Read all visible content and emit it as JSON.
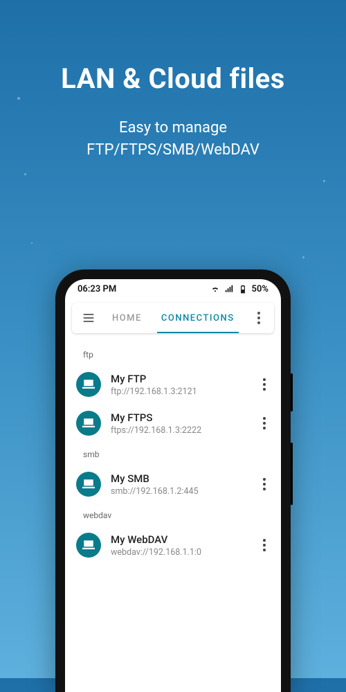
{
  "promo": {
    "title": "LAN & Cloud files",
    "line1": "Easy to manage",
    "line2": "FTP/FTPS/SMB/WebDAV"
  },
  "statusbar": {
    "time": "06:23 PM",
    "battery": "50%"
  },
  "toolbar": {
    "tabs": [
      {
        "label": "HOME",
        "active": false
      },
      {
        "label": "CONNECTIONS",
        "active": true
      }
    ]
  },
  "sections": [
    {
      "label": "ftp",
      "items": [
        {
          "title": "My FTP",
          "sub": "ftp://192.168.1.3:2121"
        },
        {
          "title": "My FTPS",
          "sub": "ftps://192.168.1.3:2222"
        }
      ]
    },
    {
      "label": "smb",
      "items": [
        {
          "title": "My SMB",
          "sub": "smb://192.168.1.2:445"
        }
      ]
    },
    {
      "label": "webdav",
      "items": [
        {
          "title": "My WebDAV",
          "sub": "webdav://192.168.1.1:0"
        }
      ]
    }
  ]
}
